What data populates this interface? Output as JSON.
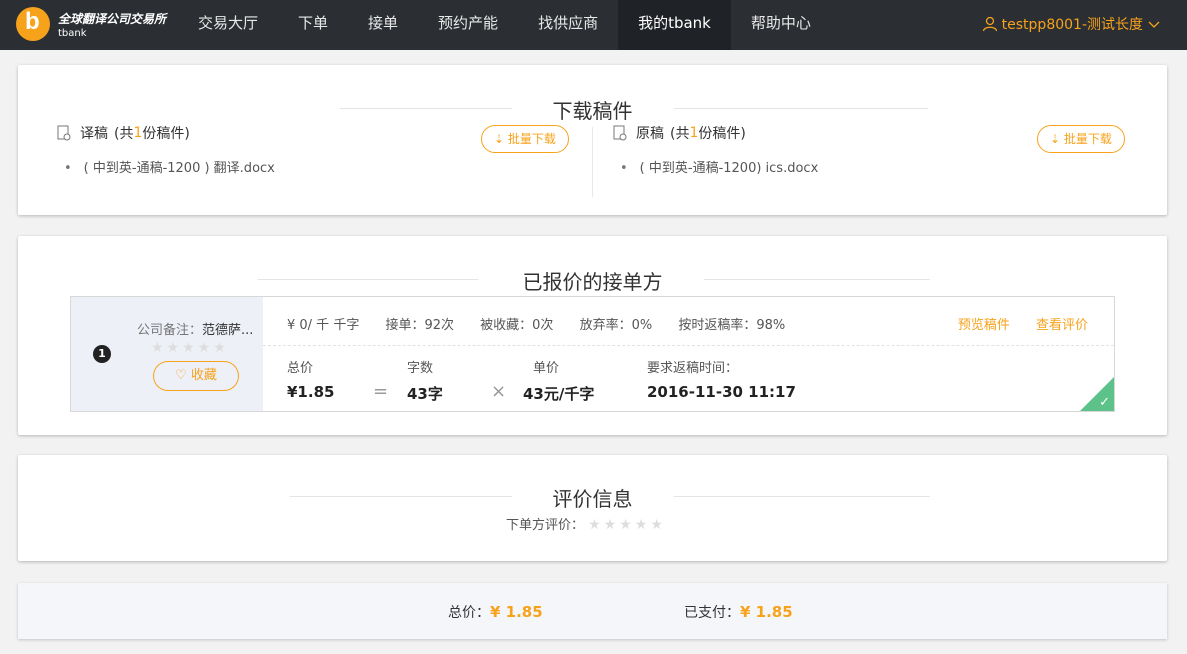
{
  "header": {
    "brand_title": "全球翻译公司交易所",
    "brand_sub": "tbank",
    "nav": [
      "交易大厅",
      "下单",
      "接单",
      "预约产能",
      "找供应商",
      "我的tbank",
      "帮助中心"
    ],
    "user": "testpp8001-测试长度"
  },
  "download": {
    "title": "下载稿件",
    "translated": {
      "label": "译稿",
      "count_prefix": "(共",
      "count": "1",
      "count_suffix": "份稿件)",
      "file": "( 中到英-通稿-1200 ) 翻译.docx",
      "button": "批量下载"
    },
    "original": {
      "label": "原稿",
      "count_prefix": "(共",
      "count": "1",
      "count_suffix": "份稿件)",
      "file": "( 中到英-通稿-1200) ics.docx",
      "button": "批量下载"
    }
  },
  "quoted": {
    "title": "已报价的接单方",
    "index": "1",
    "company_label": "公司备注：",
    "company_name": "范德萨...",
    "favorite": "收藏",
    "stats": [
      "¥ 0/ 千 千字",
      "接单：92次",
      "被收藏：0次",
      "放弃率：0%",
      "按时返稿率：98%"
    ],
    "links": [
      "预览稿件",
      "查看评价"
    ],
    "total_label": "总价",
    "total_value": "¥1.85",
    "words_label": "字数",
    "words_value": "43字",
    "unit_label": "单价",
    "unit_value": "43元/千字",
    "deadline_label": "要求返稿时间：",
    "deadline_value": "2016-11-30 11:17",
    "op_equals": "=",
    "op_times": "×"
  },
  "review": {
    "title": "评价信息",
    "label": "下单方评价："
  },
  "summary": {
    "total_label": "总价：",
    "total_value": "¥ 1.85",
    "paid_label": "已支付：",
    "paid_value": "¥ 1.85"
  },
  "colors": {
    "accent": "#f7a21b",
    "topbar": "#2b2f33",
    "success": "#5cc28a"
  }
}
